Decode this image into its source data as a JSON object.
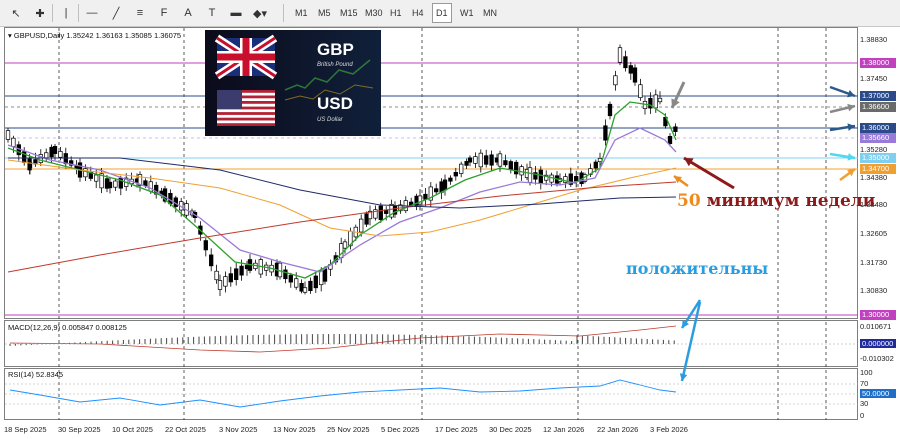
{
  "toolbar": {
    "tools": [
      {
        "name": "cursor-icon",
        "glyph": "↖"
      },
      {
        "name": "crosshair-icon",
        "glyph": "✚"
      },
      {
        "name": "vertical-line-icon",
        "glyph": "|"
      },
      {
        "name": "horizontal-line-icon",
        "glyph": "—"
      },
      {
        "name": "trendline-icon",
        "glyph": "╱"
      },
      {
        "name": "channel-icon",
        "glyph": "≡"
      },
      {
        "name": "fibonacci-icon",
        "glyph": "F"
      },
      {
        "name": "text-icon",
        "glyph": "A"
      },
      {
        "name": "text-label-icon",
        "glyph": "T"
      },
      {
        "name": "rectangle-icon",
        "glyph": "▬"
      },
      {
        "name": "shapes-icon",
        "glyph": "◆▾"
      }
    ],
    "timeframes": [
      "M1",
      "M5",
      "M15",
      "M30",
      "H1",
      "H4",
      "D1",
      "W1",
      "MN"
    ],
    "active_timeframe": "D1"
  },
  "chart": {
    "header_symbol": "GBPUSD,Daily",
    "header_ohlc": "1.35242 1.36163 1.35085 1.36075",
    "price_axis": [
      "1.38830",
      "1.37450",
      "1.36600",
      "1.35660",
      "1.35280",
      "1.34380",
      "1.33480",
      "1.32605",
      "1.31730",
      "1.30830"
    ],
    "price_badges": [
      {
        "value": "1.38000",
        "color": "#c040c0"
      },
      {
        "value": "1.37000",
        "color": "#2a4a8a"
      },
      {
        "value": "1.36600",
        "color": "#6a6a6a"
      },
      {
        "value": "1.36000",
        "color": "#2a4a8a"
      },
      {
        "value": "1.35660",
        "color": "#9a7ad8"
      },
      {
        "value": "1.35000",
        "color": "#7fd0f0"
      },
      {
        "value": "1.34700",
        "color": "#f0a030"
      },
      {
        "value": "1.30000",
        "color": "#c040c0"
      }
    ],
    "time_axis": [
      "18 Sep 2025",
      "30 Sep 2025",
      "10 Oct 2025",
      "22 Oct 2025",
      "3 Nov 2025",
      "13 Nov 2025",
      "25 Nov 2025",
      "5 Dec 2025",
      "17 Dec 2025",
      "30 Dec 2025",
      "12 Jan 2026",
      "22 Jan 2026",
      "3 Feb 2026"
    ]
  },
  "overlay": {
    "pair_top": "GBP",
    "pair_top_sub": "British Pound",
    "pair_bottom": "USD",
    "pair_bottom_sub": "US Dollar"
  },
  "macd": {
    "label": "MACD(12,26,9) 0.005847 0.008125",
    "axis": [
      "0.010671",
      "0.000000",
      "-0.010302"
    ]
  },
  "rsi": {
    "label": "RSI(14) 52.8345",
    "axis": [
      "100",
      "70",
      "50.0000",
      "30",
      "0"
    ]
  },
  "annotations": {
    "week_min": "50 минимум недели",
    "positive": "положительны"
  },
  "colors": {
    "candle": "#000000",
    "ma_fast": "#2ca02c",
    "ma_mid": "#9a7ad8",
    "ma_slow_orange": "#f0a030",
    "ma_red": "#c0392b",
    "ma_navy": "#1f2a6b",
    "annotation_orange": "#f08a1c",
    "annotation_darkred": "#8b1a1a",
    "annotation_blue": "#2a9de0"
  }
}
